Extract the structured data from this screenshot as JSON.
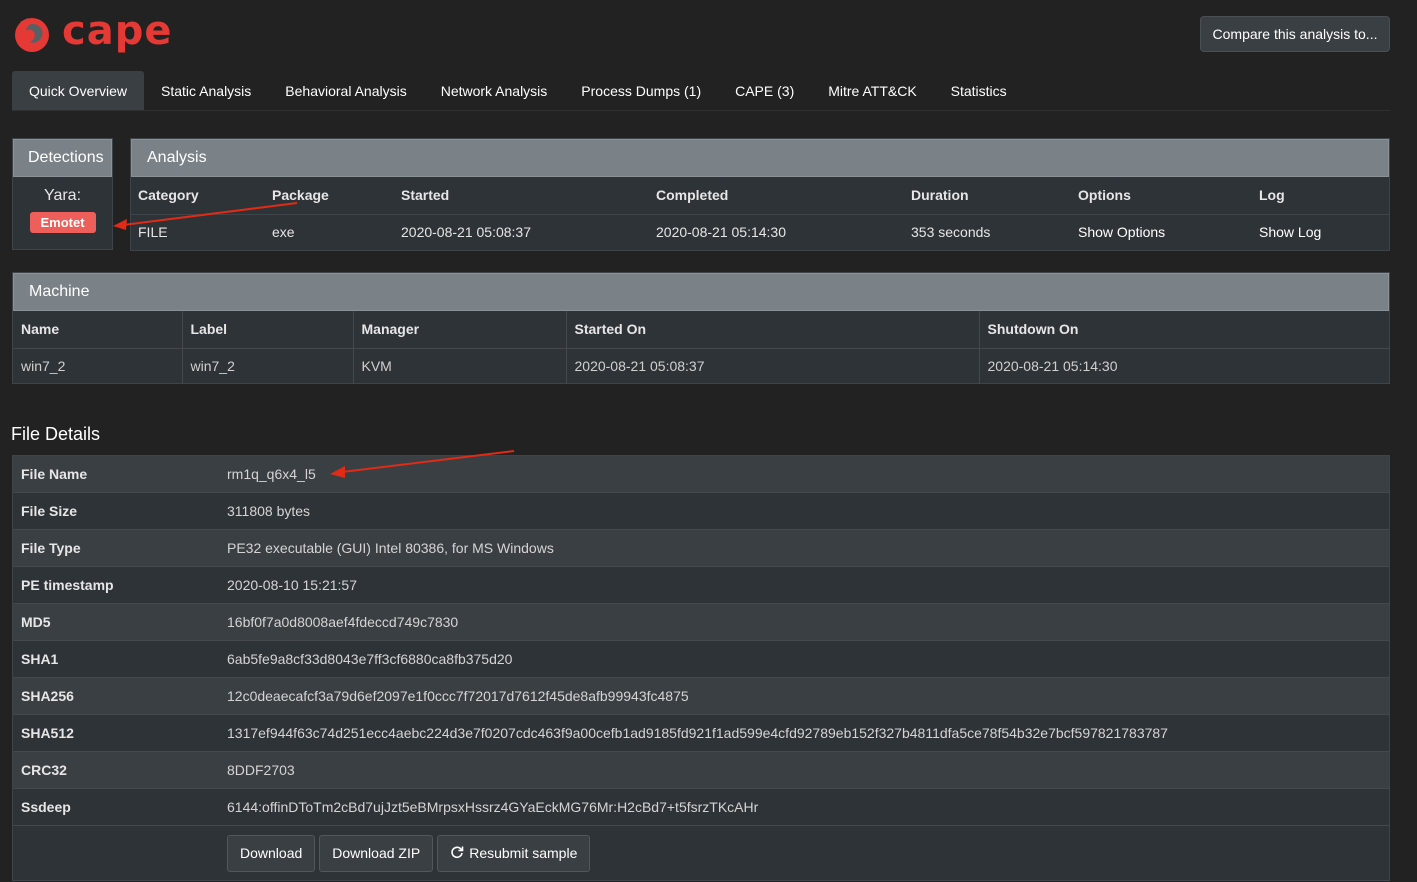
{
  "app": {
    "logo_text": "cape"
  },
  "header": {
    "compare_label": "Compare this analysis to..."
  },
  "tabs": [
    {
      "label": "Quick Overview",
      "active": true
    },
    {
      "label": "Static Analysis"
    },
    {
      "label": "Behavioral Analysis"
    },
    {
      "label": "Network Analysis"
    },
    {
      "label": "Process Dumps (1)"
    },
    {
      "label": "CAPE (3)"
    },
    {
      "label": "Mitre ATT&CK"
    },
    {
      "label": "Statistics"
    }
  ],
  "detections": {
    "title": "Detections",
    "yara_label": "Yara:",
    "badge": "Emotet"
  },
  "analysis": {
    "title": "Analysis",
    "headers": [
      "Category",
      "Package",
      "Started",
      "Completed",
      "Duration",
      "Options",
      "Log"
    ],
    "row": [
      "FILE",
      "exe",
      "2020-08-21 05:08:37",
      "2020-08-21 05:14:30",
      "353 seconds",
      "Show Options",
      "Show Log"
    ]
  },
  "machine": {
    "title": "Machine",
    "headers": [
      "Name",
      "Label",
      "Manager",
      "Started On",
      "Shutdown On"
    ],
    "row": [
      "win7_2",
      "win7_2",
      "KVM",
      "2020-08-21 05:08:37",
      "2020-08-21 05:14:30"
    ]
  },
  "file_details": {
    "title": "File Details",
    "rows": [
      {
        "key": "File Name",
        "value": "rm1q_q6x4_l5"
      },
      {
        "key": "File Size",
        "value": "311808 bytes"
      },
      {
        "key": "File Type",
        "value": "PE32 executable (GUI) Intel 80386, for MS Windows"
      },
      {
        "key": "PE timestamp",
        "value": "2020-08-10 15:21:57"
      },
      {
        "key": "MD5",
        "value": "16bf0f7a0d8008aef4fdeccd749c7830"
      },
      {
        "key": "SHA1",
        "value": "6ab5fe9a8cf33d8043e7ff3cf6880ca8fb375d20"
      },
      {
        "key": "SHA256",
        "value": "12c0deaecafcf3a79d6ef2097e1f0ccc7f72017d7612f45de8afb99943fc4875"
      },
      {
        "key": "SHA512",
        "value": "1317ef944f63c74d251ecc4aebc224d3e7f0207cdc463f9a00cefb1ad9185fd921f1ad599e4cfd92789eb152f327b4811dfa5ce78f54b32e7bcf597821783787"
      },
      {
        "key": "CRC32",
        "value": "8DDF2703"
      },
      {
        "key": "Ssdeep",
        "value": "6144:offinDToTm2cBd7ujJzt5eBMrpsxHssrz4GYaEckMG76Mr:H2cBd7+t5fsrzTKcAHr"
      }
    ],
    "actions": {
      "download": "Download",
      "download_zip": "Download ZIP",
      "resubmit": "Resubmit sample"
    }
  },
  "colors": {
    "accent": "#e53935",
    "badge": "#ee5f5b",
    "arrow": "#e02b17"
  }
}
